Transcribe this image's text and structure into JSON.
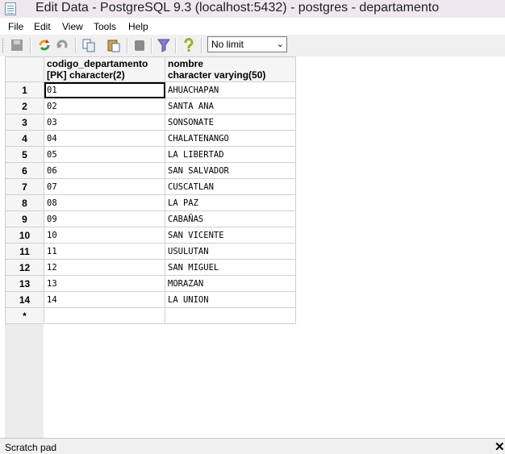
{
  "window": {
    "title": "Edit Data - PostgreSQL 9.3 (localhost:5432) - postgres - departamento"
  },
  "menu": {
    "file": "File",
    "edit": "Edit",
    "view": "View",
    "tools": "Tools",
    "help": "Help"
  },
  "toolbar": {
    "row_limit": "No limit"
  },
  "grid": {
    "columns": [
      {
        "name": "codigo_departamento",
        "type": "[PK] character(2)"
      },
      {
        "name": "nombre",
        "type": "character varying(50)"
      }
    ],
    "rows": [
      {
        "num": "1",
        "codigo": "01",
        "nombre": "AHUACHAPAN"
      },
      {
        "num": "2",
        "codigo": "02",
        "nombre": "SANTA ANA"
      },
      {
        "num": "3",
        "codigo": "03",
        "nombre": "SONSONATE"
      },
      {
        "num": "4",
        "codigo": "04",
        "nombre": "CHALATENANGO"
      },
      {
        "num": "5",
        "codigo": "05",
        "nombre": "LA LIBERTAD"
      },
      {
        "num": "6",
        "codigo": "06",
        "nombre": "SAN SALVADOR"
      },
      {
        "num": "7",
        "codigo": "07",
        "nombre": "CUSCATLAN"
      },
      {
        "num": "8",
        "codigo": "08",
        "nombre": "LA PAZ"
      },
      {
        "num": "9",
        "codigo": "09",
        "nombre": "CABAÑAS"
      },
      {
        "num": "10",
        "codigo": "10",
        "nombre": "SAN VICENTE"
      },
      {
        "num": "11",
        "codigo": "11",
        "nombre": "USULUTAN"
      },
      {
        "num": "12",
        "codigo": "12",
        "nombre": "SAN MIGUEL"
      },
      {
        "num": "13",
        "codigo": "13",
        "nombre": "MORAZAN"
      },
      {
        "num": "14",
        "codigo": "14",
        "nombre": "LA UNION"
      }
    ],
    "new_row_marker": "*"
  },
  "scratch": {
    "label": "Scratch pad",
    "close": "✕"
  }
}
